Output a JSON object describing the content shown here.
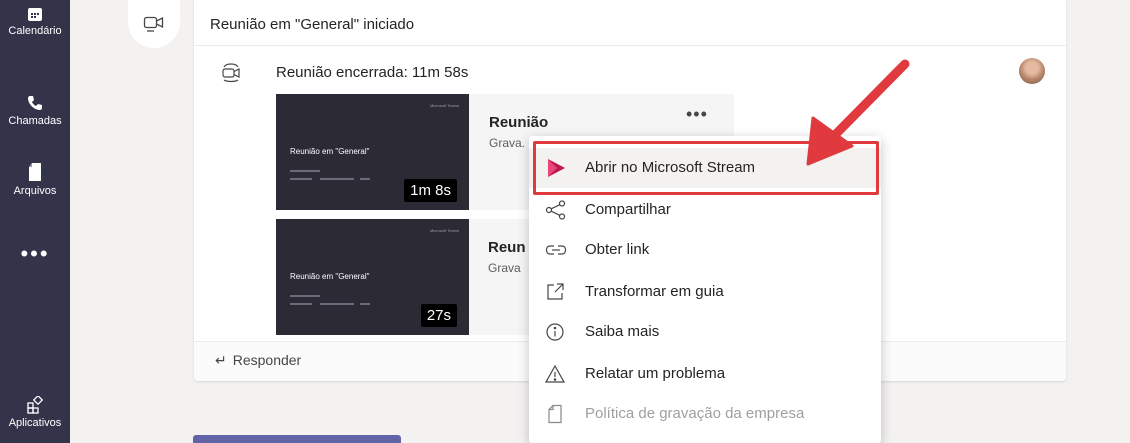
{
  "rail": {
    "items": [
      {
        "label": "Calendário",
        "icon": "calendar-icon"
      },
      {
        "label": "Chamadas",
        "icon": "phone-icon"
      },
      {
        "label": "Arquivos",
        "icon": "file-icon"
      },
      {
        "label": "Aplicativos",
        "icon": "apps-icon"
      }
    ],
    "more": "•••"
  },
  "thread": {
    "title": "Reunião em \"General\" iniciado",
    "ended": "Reunião encerrada: 11m 58s",
    "reply": "Responder"
  },
  "recordings": [
    {
      "thumb_brand": "Microsoft Teams",
      "thumb_title": "Reunião em \"General\"",
      "duration": "1m 8s",
      "name": "Reunião",
      "sub": "Grava..."
    },
    {
      "thumb_brand": "Microsoft Teams",
      "thumb_title": "Reunião em \"General\"",
      "duration": "27s",
      "name": "Reun",
      "sub": "Grava"
    }
  ],
  "more_options": "•••",
  "menu": {
    "items": [
      {
        "label": "Abrir no Microsoft Stream",
        "icon": "stream-icon",
        "state": "highlighted"
      },
      {
        "label": "Compartilhar",
        "icon": "share-icon",
        "state": "normal"
      },
      {
        "label": "Obter link",
        "icon": "link-icon",
        "state": "normal"
      },
      {
        "label": "Transformar em guia",
        "icon": "open-external-icon",
        "state": "normal"
      },
      {
        "label": "Saiba mais",
        "icon": "info-icon",
        "state": "normal"
      },
      {
        "label": "Relatar um problema",
        "icon": "warning-icon",
        "state": "normal"
      },
      {
        "label": "Política de gravação da empresa",
        "icon": "document-icon",
        "state": "disabled"
      }
    ]
  },
  "colors": {
    "rail": "#33344a",
    "brand": "#6264a7",
    "annotation": "#e0393e",
    "stream": "#bc1948"
  }
}
